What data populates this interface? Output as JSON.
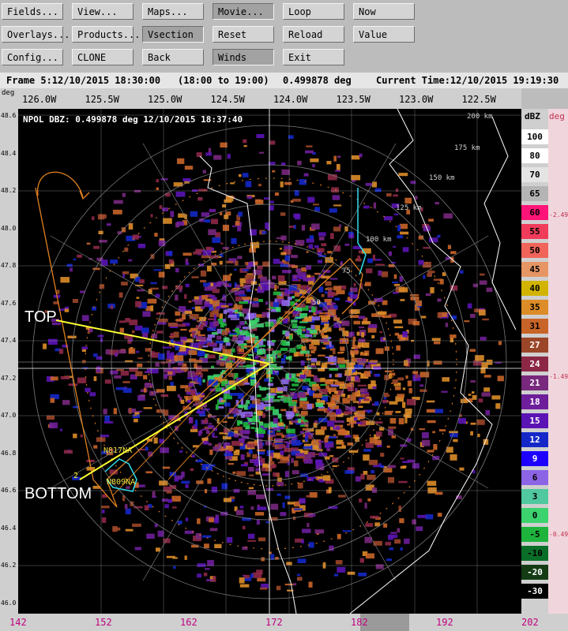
{
  "toolbar": {
    "buttons": [
      {
        "label": "Fields...",
        "pressed": false
      },
      {
        "label": "View...",
        "pressed": false
      },
      {
        "label": "Maps...",
        "pressed": false
      },
      {
        "label": "Movie...",
        "pressed": true
      },
      {
        "label": "Loop",
        "pressed": false
      },
      {
        "label": "Now",
        "pressed": false
      },
      {
        "label": "Overlays...",
        "pressed": false
      },
      {
        "label": "Products...",
        "pressed": false
      },
      {
        "label": "Vsection",
        "pressed": true
      },
      {
        "label": "Reset",
        "pressed": false
      },
      {
        "label": "Reload",
        "pressed": false
      },
      {
        "label": "Value",
        "pressed": false
      },
      {
        "label": "Config...",
        "pressed": false
      },
      {
        "label": "CLONE",
        "pressed": false
      },
      {
        "label": "Back",
        "pressed": false
      },
      {
        "label": "Winds",
        "pressed": true
      },
      {
        "label": "Exit",
        "pressed": false
      }
    ]
  },
  "status": {
    "frame": "Frame 5:12/10/2015 18:30:00",
    "range": "(18:00 to 19:00)",
    "elevation": "0.499878 deg",
    "current_time": "Current Time:12/10/2015 19:19:30"
  },
  "plot": {
    "title": "NPOL DBZ: 0.499878 deg 12/10/2015 18:37:40",
    "lon_ticks": [
      "126.0W",
      "125.5W",
      "125.0W",
      "124.5W",
      "124.0W",
      "123.5W",
      "123.0W",
      "122.5W"
    ],
    "lat_ticks": [
      "48.6",
      "48.4",
      "48.2",
      "48.0",
      "47.8",
      "47.6",
      "47.4",
      "47.2",
      "47.0",
      "46.8",
      "46.6",
      "46.4",
      "46.2",
      "46.0"
    ],
    "deg_label": "deg",
    "bottom_ticks": [
      "142",
      "152",
      "162",
      "172",
      "182",
      "192",
      "202"
    ],
    "range_rings": [
      "200 km",
      "175 km",
      "150 km",
      "125 km",
      "100 km",
      "75",
      "50"
    ],
    "annotations": {
      "top": "TOP",
      "bottom": "BOTTOM",
      "point1": "1",
      "point2": "2",
      "aircraft1": "N817NA",
      "aircraft2": "N809NA"
    }
  },
  "colorbar": {
    "title": "dBZ",
    "entries": [
      {
        "label": "100",
        "color": "#ffffff",
        "text": "#000000"
      },
      {
        "label": "80",
        "color": "#ffffff",
        "text": "#000000"
      },
      {
        "label": "70",
        "color": "#e4e4e4",
        "text": "#000000"
      },
      {
        "label": "65",
        "color": "#b4b4b4",
        "text": "#000000"
      },
      {
        "label": "60",
        "color": "#ff1478",
        "text": "#000000"
      },
      {
        "label": "55",
        "color": "#f03c5a",
        "text": "#000000"
      },
      {
        "label": "50",
        "color": "#f0645a",
        "text": "#000000"
      },
      {
        "label": "45",
        "color": "#e69664",
        "text": "#000000"
      },
      {
        "label": "40",
        "color": "#d2b400",
        "text": "#000000"
      },
      {
        "label": "35",
        "color": "#dc8c28",
        "text": "#000000"
      },
      {
        "label": "31",
        "color": "#c86428",
        "text": "#000000"
      },
      {
        "label": "27",
        "color": "#9b4628",
        "text": "#ffffff"
      },
      {
        "label": "24",
        "color": "#8c2846",
        "text": "#ffffff"
      },
      {
        "label": "21",
        "color": "#78287d",
        "text": "#ffffff"
      },
      {
        "label": "18",
        "color": "#6e1e9b",
        "text": "#ffffff"
      },
      {
        "label": "15",
        "color": "#5a14b4",
        "text": "#ffffff"
      },
      {
        "label": "12",
        "color": "#1428c8",
        "text": "#ffffff"
      },
      {
        "label": "9",
        "color": "#1e00ff",
        "text": "#ffffff"
      },
      {
        "label": "6",
        "color": "#8c64e6",
        "text": "#000000"
      },
      {
        "label": "3",
        "color": "#50c8a0",
        "text": "#000000"
      },
      {
        "label": "0",
        "color": "#3cd26e",
        "text": "#000000"
      },
      {
        "label": "-5",
        "color": "#1eb43c",
        "text": "#000000"
      },
      {
        "label": "-10",
        "color": "#0a6e28",
        "text": "#000000"
      },
      {
        "label": "-20",
        "color": "#143c14",
        "text": "#ffffff"
      },
      {
        "label": "-30",
        "color": "#000000",
        "text": "#ffffff"
      }
    ]
  },
  "elevation_axis": {
    "title": "deg",
    "ticks": [
      "2.49",
      "1.49",
      "0.49"
    ]
  }
}
